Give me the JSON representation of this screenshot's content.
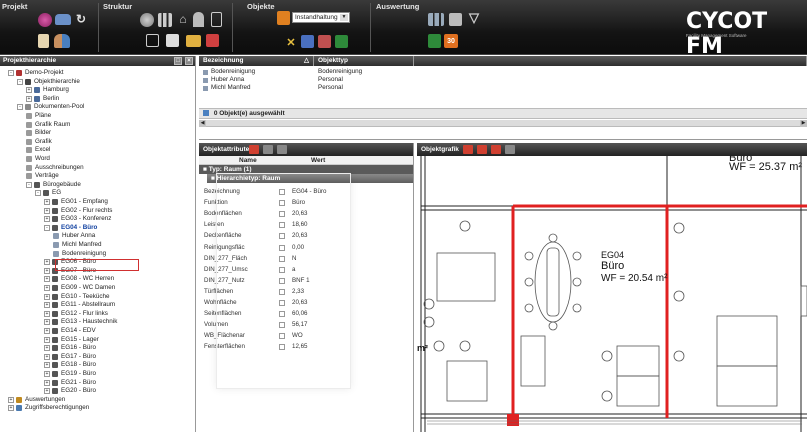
{
  "toolbar": {
    "projekt_label": "Projekt",
    "struktur_label": "Struktur",
    "objekte_label": "Objekte",
    "objekte_select": "Instandhaltung",
    "auswertung_label": "Auswertung",
    "calendar_badge": "30",
    "logo": "CYCOT FM",
    "logo_sub": "Facility Management Software"
  },
  "left_panel": {
    "title": "Projekthierarchie",
    "tree": [
      {
        "label": "Demo-Projekt",
        "depth": 0,
        "expander": "-",
        "icon": "#b03030"
      },
      {
        "label": "Objekthierarchie",
        "depth": 1,
        "expander": "-",
        "icon": "#444444"
      },
      {
        "label": "Hamburg",
        "depth": 2,
        "expander": "+",
        "icon": "#4a6a9a"
      },
      {
        "label": "Berlin",
        "depth": 2,
        "expander": "+",
        "icon": "#4a6a9a"
      },
      {
        "label": "Dokumenten-Pool",
        "depth": 1,
        "expander": "-",
        "icon": "#8a8a8a"
      },
      {
        "label": "Pläne",
        "depth": 2,
        "expander": "",
        "icon": "#9a9a9a"
      },
      {
        "label": "Grafik Raum",
        "depth": 2,
        "expander": "",
        "icon": "#9a9a9a"
      },
      {
        "label": "Bilder",
        "depth": 2,
        "expander": "",
        "icon": "#9a9a9a"
      },
      {
        "label": "Grafik",
        "depth": 2,
        "expander": "",
        "icon": "#9a9a9a"
      },
      {
        "label": "Excel",
        "depth": 2,
        "expander": "",
        "icon": "#9a9a9a"
      },
      {
        "label": "Word",
        "depth": 2,
        "expander": "",
        "icon": "#9a9a9a"
      },
      {
        "label": "Ausschreibungen",
        "depth": 2,
        "expander": "",
        "icon": "#9a9a9a"
      },
      {
        "label": "Verträge",
        "depth": 2,
        "expander": "",
        "icon": "#9a9a9a"
      },
      {
        "label": "Bürogebäude",
        "depth": 2,
        "expander": "-",
        "icon": "#555555"
      },
      {
        "label": "EG",
        "depth": 3,
        "expander": "-",
        "icon": "#555555"
      },
      {
        "label": "EG01 - Empfang",
        "depth": 4,
        "expander": "+",
        "icon": "#555555"
      },
      {
        "label": "EG02 - Flur rechts",
        "depth": 4,
        "expander": "+",
        "icon": "#555555"
      },
      {
        "label": "EG03 - Konferenz",
        "depth": 4,
        "expander": "+",
        "icon": "#555555"
      },
      {
        "label": "EG04 - Büro",
        "depth": 4,
        "expander": "-",
        "icon": "#555555",
        "selected": true
      },
      {
        "label": "Huber Anna",
        "depth": 5,
        "expander": "",
        "icon": "#8a9ab0"
      },
      {
        "label": "Michl Manfred",
        "depth": 5,
        "expander": "",
        "icon": "#8a9ab0"
      },
      {
        "label": "Bodenreinigung",
        "depth": 5,
        "expander": "",
        "icon": "#8a9ab0"
      },
      {
        "label": "EG06 - Büro",
        "depth": 4,
        "expander": "+",
        "icon": "#555555"
      },
      {
        "label": "EG07 - Büro",
        "depth": 4,
        "expander": "+",
        "icon": "#555555"
      },
      {
        "label": "EG08 - WC Herren",
        "depth": 4,
        "expander": "+",
        "icon": "#555555"
      },
      {
        "label": "EG09 - WC Damen",
        "depth": 4,
        "expander": "+",
        "icon": "#555555"
      },
      {
        "label": "EG10 - Teeküche",
        "depth": 4,
        "expander": "+",
        "icon": "#555555"
      },
      {
        "label": "EG11 - Abstellraum",
        "depth": 4,
        "expander": "+",
        "icon": "#555555"
      },
      {
        "label": "EG12 - Flur links",
        "depth": 4,
        "expander": "+",
        "icon": "#555555"
      },
      {
        "label": "EG13 - Haustechnik",
        "depth": 4,
        "expander": "+",
        "icon": "#555555"
      },
      {
        "label": "EG14 - EDV",
        "depth": 4,
        "expander": "+",
        "icon": "#555555"
      },
      {
        "label": "EG15 - Lager",
        "depth": 4,
        "expander": "+",
        "icon": "#555555"
      },
      {
        "label": "EG16 - Büro",
        "depth": 4,
        "expander": "+",
        "icon": "#555555"
      },
      {
        "label": "EG17 - Büro",
        "depth": 4,
        "expander": "+",
        "icon": "#555555"
      },
      {
        "label": "EG18 - Büro",
        "depth": 4,
        "expander": "+",
        "icon": "#555555"
      },
      {
        "label": "EG19 - Büro",
        "depth": 4,
        "expander": "+",
        "icon": "#555555"
      },
      {
        "label": "EG21 - Büro",
        "depth": 4,
        "expander": "+",
        "icon": "#555555"
      },
      {
        "label": "EG20 - Büro",
        "depth": 4,
        "expander": "+",
        "icon": "#555555"
      },
      {
        "label": "Auswertungen",
        "depth": 0,
        "expander": "+",
        "icon": "#c08a20"
      },
      {
        "label": "Zugriffsberechtigungen",
        "depth": 0,
        "expander": "+",
        "icon": "#4a7ab0"
      }
    ]
  },
  "top_list": {
    "col_bezeichnung": "Bezeichnung",
    "col_objekttyp": "Objekttyp",
    "sort_indicator": "△",
    "rows": [
      {
        "bezeichnung": "Bodenreinigung",
        "objekttyp": "Bodenreinigung"
      },
      {
        "bezeichnung": "Huber Anna",
        "objekttyp": "Personal"
      },
      {
        "bezeichnung": "Michl Manfred",
        "objekttyp": "Personal"
      }
    ],
    "status": "0 Objekt(e) ausgewählt"
  },
  "attr_panel": {
    "title": "Objektattribute",
    "col_name": "Name",
    "col_wert": "Wert",
    "type_group": "Typ: Raum (1)",
    "sub_group": "Hierarchietyp: Raum",
    "rows": [
      {
        "name": "Bezeichnung",
        "value": "EG04 - Büro"
      },
      {
        "name": "Funktion",
        "value": "Büro"
      },
      {
        "name": "Bodenflächen",
        "value": "20,63"
      },
      {
        "name": "Leisten",
        "value": "18,60"
      },
      {
        "name": "Deckenfläche",
        "value": "20,63"
      },
      {
        "name": "Reinigungsfläc",
        "value": "0,00"
      },
      {
        "name": "DIN_277_Fläch",
        "value": "N"
      },
      {
        "name": "DIN_277_Umsc",
        "value": "a"
      },
      {
        "name": "DIN_277_Nutz",
        "value": "BNF 1"
      },
      {
        "name": "Türflächen",
        "value": "2,33"
      },
      {
        "name": "Wohnfläche",
        "value": "20,63"
      },
      {
        "name": "Seitenflächen",
        "value": "60,06"
      },
      {
        "name": "Volumen",
        "value": "56,17"
      },
      {
        "name": "WB_Flächenar",
        "value": "WO"
      },
      {
        "name": "Fensterflächen",
        "value": "12,65"
      }
    ]
  },
  "graph_panel": {
    "title": "Objektgrafik",
    "room1_id": "EG04",
    "room1_name": "Büro",
    "room1_area": "WF = 20.54 m²",
    "room2_name": "Büro",
    "room2_area": "WF = 25.37 m²",
    "left_fragment": "m²"
  },
  "colors": {
    "highlight_wall": "#e02020",
    "toolbar_bg": "#1c1c1c",
    "selection_border": "#d03030"
  }
}
